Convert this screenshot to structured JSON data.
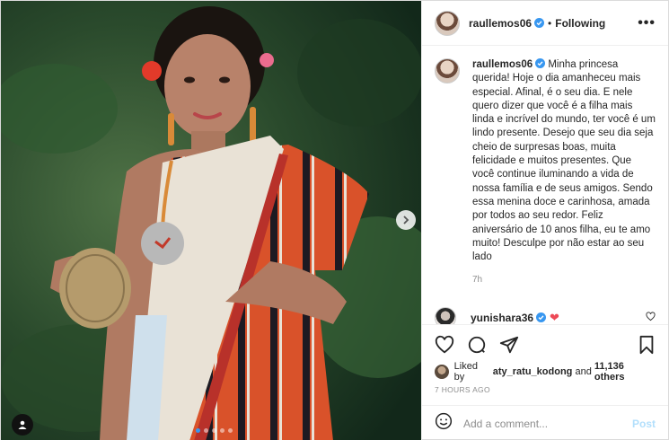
{
  "header": {
    "username": "raullemos06",
    "separator": "•",
    "follow_status": "Following",
    "more_label": "•••"
  },
  "caption": {
    "username": "raullemos06",
    "text": "Minha princesa querida! Hoje o dia amanheceu mais especial. Afinal, é o seu dia. E nele quero dizer que você é a filha mais linda e incrível do mundo, ter você é um lindo presente. Desejo que seu dia seja cheio de surpresas boas, muita felicidade e muitos presentes. Que você continue iluminando a vida de nossa família e de seus amigos. Sendo essa menina doce e carinhosa, amada por todos ao seu redor. Feliz aniversário de 10 anos filha, eu te amo muito! Desculpe por não estar ao seu lado",
    "time": "7h"
  },
  "reply": {
    "username": "yunishara36",
    "emoji": "❤"
  },
  "likes": {
    "prefix": "Liked by",
    "user": "aty_ratu_kodong",
    "conj": "and",
    "count": "11,136 others"
  },
  "post_time": "7 HOURS AGO",
  "comment_box": {
    "placeholder": "Add a comment...",
    "post_label": "Post"
  },
  "carousel": {
    "total": 5,
    "active": 0
  },
  "colors": {
    "accent": "#3897f0",
    "verified": "#3897f0",
    "post_disabled": "#b2dffc",
    "heart_red": "#ed4956"
  }
}
